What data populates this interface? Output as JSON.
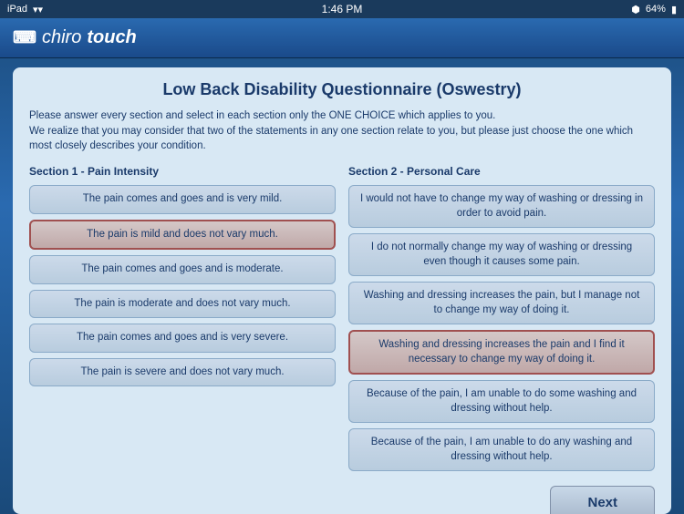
{
  "statusBar": {
    "left": "iPad",
    "time": "1:46 PM",
    "battery": "64%",
    "wifi": "wifi"
  },
  "header": {
    "logo_chiro": "chiro",
    "logo_touch": "touch"
  },
  "page": {
    "title": "Low Back Disability Questionnaire (Oswestry)",
    "instructions_line1": "Please answer every section and select in each section only the ONE CHOICE which applies to you.",
    "instructions_line2": "We realize that you may consider that two of the statements in any one section relate to you, but please just choose the one which most closely describes your condition."
  },
  "section1": {
    "title": "Section 1 - Pain Intensity",
    "options": [
      {
        "id": "s1_0",
        "label": "The pain comes and goes and is very mild.",
        "selected": false
      },
      {
        "id": "s1_1",
        "label": "The pain is mild and does not vary much.",
        "selected": true
      },
      {
        "id": "s1_2",
        "label": "The pain comes and goes and is moderate.",
        "selected": false
      },
      {
        "id": "s1_3",
        "label": "The pain is moderate and does not vary much.",
        "selected": false
      },
      {
        "id": "s1_4",
        "label": "The pain comes and goes and is very severe.",
        "selected": false
      },
      {
        "id": "s1_5",
        "label": "The pain is severe and does not vary much.",
        "selected": false
      }
    ]
  },
  "section2": {
    "title": "Section 2 - Personal Care",
    "options": [
      {
        "id": "s2_0",
        "label": "I would not have to change my way of washing or dressing in order to avoid pain.",
        "selected": false
      },
      {
        "id": "s2_1",
        "label": "I do not normally change my way of washing or dressing even though it causes some pain.",
        "selected": false
      },
      {
        "id": "s2_2",
        "label": "Washing and dressing increases the pain, but I manage not to change my way of doing it.",
        "selected": false
      },
      {
        "id": "s2_3",
        "label": "Washing and dressing increases the pain and I find it necessary to change my way of doing it.",
        "selected": true
      },
      {
        "id": "s2_4",
        "label": "Because of the pain, I am unable to do some washing and dressing without help.",
        "selected": false
      },
      {
        "id": "s2_5",
        "label": "Because of the pain, I am unable to do any washing and dressing without help.",
        "selected": false
      }
    ]
  },
  "nextButton": {
    "label": "Next"
  }
}
